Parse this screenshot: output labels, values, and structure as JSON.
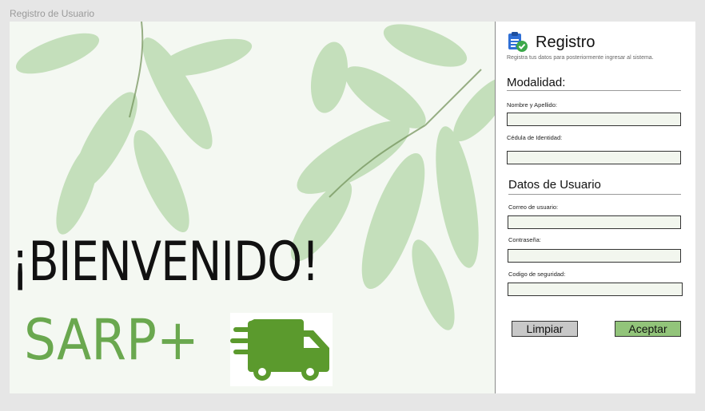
{
  "window": {
    "title": "Registro de Usuario"
  },
  "hero": {
    "welcome": "¡BIENVENIDO!",
    "brand": "SARP+",
    "brand_color": "#6aa84f",
    "truck_icon": "delivery-truck-icon"
  },
  "form": {
    "title": "Registro",
    "subtitle": "Registra tus datos para posteriormente ingresar al sistema.",
    "header_icon": "clipboard-check-icon",
    "section_modalidad": "Modalidad:",
    "fields_modalidad": [
      {
        "label": "Nombre y Apellido:",
        "value": "",
        "placeholder": ""
      },
      {
        "label": "Cédula de Identidad:",
        "value": "",
        "placeholder": ""
      }
    ],
    "section_usuario": "Datos de Usuario",
    "fields_usuario": [
      {
        "label": "Correo de usuario:",
        "value": "",
        "placeholder": ""
      },
      {
        "label": "Contraseña:",
        "value": "",
        "placeholder": ""
      },
      {
        "label": "Codigo de seguridad:",
        "value": "",
        "placeholder": ""
      }
    ],
    "buttons": {
      "clear": "Limpiar",
      "accept": "Aceptar"
    },
    "colors": {
      "accept_bg": "#92c47a",
      "clear_bg": "#c8c8c8",
      "input_bg": "#f2f6ee"
    }
  }
}
